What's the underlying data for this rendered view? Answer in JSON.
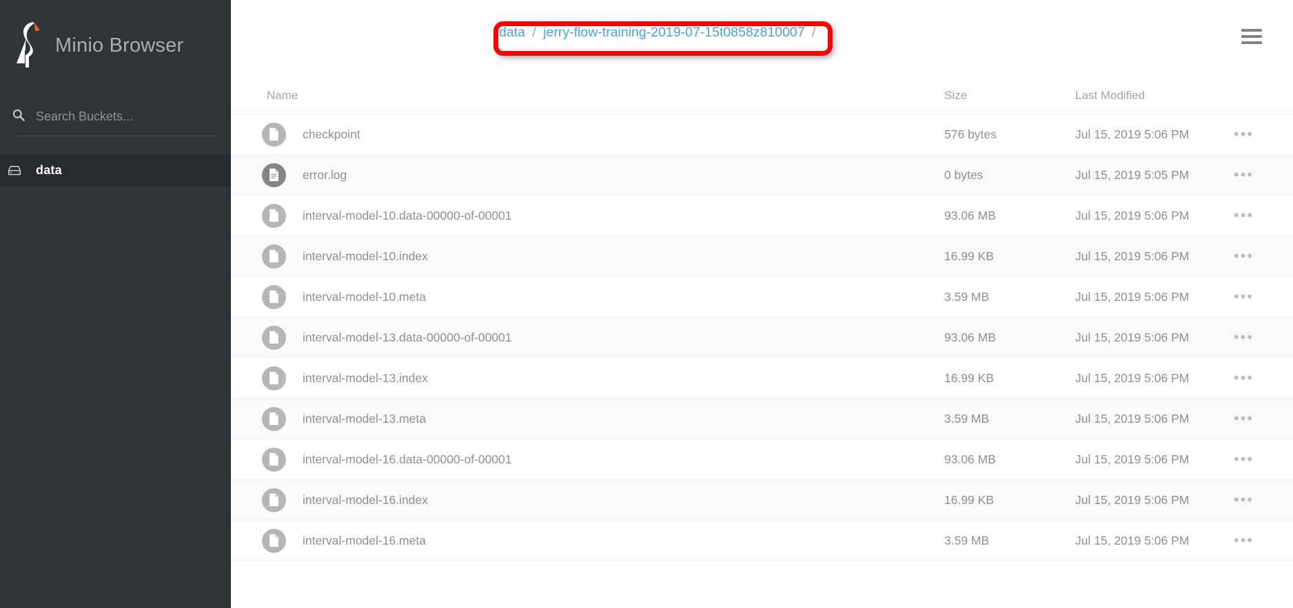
{
  "sidebar": {
    "brand_title": "Minio Browser",
    "logo_icon": "minio-stork-logo",
    "search": {
      "icon": "search-icon",
      "placeholder": "Search Buckets...",
      "value": ""
    },
    "buckets": [
      {
        "label": "data",
        "icon": "bucket-drive-icon",
        "active": true
      }
    ]
  },
  "topbar": {
    "breadcrumb": {
      "root": "data",
      "separator": "/",
      "folder": "jerry-flow-training-2019-07-15t0858z810007",
      "trailing_separator": "/"
    },
    "menu_icon": "hamburger-menu-icon",
    "annotation_color": "#ff0000"
  },
  "table": {
    "columns": {
      "name": "Name",
      "size": "Size",
      "modified": "Last Modified",
      "actions": ""
    },
    "action_glyph": "•••",
    "rows": [
      {
        "name": "checkpoint",
        "size": "576 bytes",
        "modified": "Jul 15, 2019 5:06 PM",
        "icon": "file-doc-icon"
      },
      {
        "name": "error.log",
        "size": "0 bytes",
        "modified": "Jul 15, 2019 5:05 PM",
        "icon": "file-text-icon"
      },
      {
        "name": "interval-model-10.data-00000-of-00001",
        "size": "93.06 MB",
        "modified": "Jul 15, 2019 5:06 PM",
        "icon": "file-doc-icon"
      },
      {
        "name": "interval-model-10.index",
        "size": "16.99 KB",
        "modified": "Jul 15, 2019 5:06 PM",
        "icon": "file-doc-icon"
      },
      {
        "name": "interval-model-10.meta",
        "size": "3.59 MB",
        "modified": "Jul 15, 2019 5:06 PM",
        "icon": "file-doc-icon"
      },
      {
        "name": "interval-model-13.data-00000-of-00001",
        "size": "93.06 MB",
        "modified": "Jul 15, 2019 5:06 PM",
        "icon": "file-doc-icon"
      },
      {
        "name": "interval-model-13.index",
        "size": "16.99 KB",
        "modified": "Jul 15, 2019 5:06 PM",
        "icon": "file-doc-icon"
      },
      {
        "name": "interval-model-13.meta",
        "size": "3.59 MB",
        "modified": "Jul 15, 2019 5:06 PM",
        "icon": "file-doc-icon"
      },
      {
        "name": "interval-model-16.data-00000-of-00001",
        "size": "93.06 MB",
        "modified": "Jul 15, 2019 5:06 PM",
        "icon": "file-doc-icon"
      },
      {
        "name": "interval-model-16.index",
        "size": "16.99 KB",
        "modified": "Jul 15, 2019 5:06 PM",
        "icon": "file-doc-icon"
      },
      {
        "name": "interval-model-16.meta",
        "size": "3.59 MB",
        "modified": "Jul 15, 2019 5:06 PM",
        "icon": "file-doc-icon"
      }
    ]
  },
  "colors": {
    "sidebar_bg": "#2e3438",
    "sidebar_active_bg": "#262b30",
    "link_blue": "#4aa3e0",
    "text_gray": "#8c9196",
    "logo_accent": "#f2622c"
  }
}
